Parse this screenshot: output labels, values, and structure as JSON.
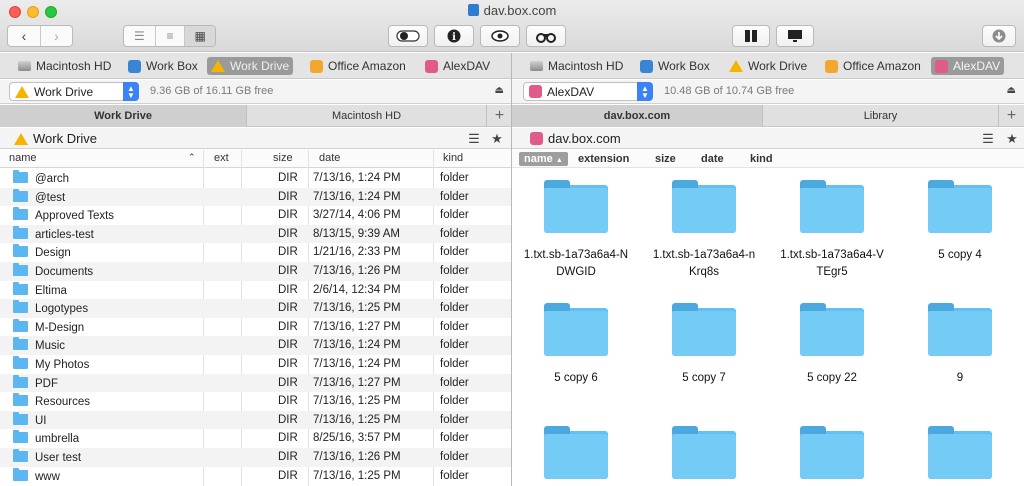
{
  "window": {
    "title": "dav.box.com"
  },
  "toolbar": {
    "back_icon": "chevron-left-icon",
    "forward_icon": "chevron-right-icon",
    "view_modes": [
      "list-view-icon",
      "detail-view-icon",
      "icon-view-icon"
    ],
    "buttons": [
      "toggle-icon",
      "info-icon",
      "eye-icon",
      "binoculars-icon",
      "pane-toggle-icon",
      "share-screen-icon",
      "download-icon"
    ]
  },
  "left": {
    "favorites": [
      {
        "label": "Macintosh HD",
        "icon": "harddrive-icon"
      },
      {
        "label": "Work Box",
        "icon": "box-icon"
      },
      {
        "label": "Work Drive",
        "icon": "google-drive-icon"
      },
      {
        "label": "Office Amazon",
        "icon": "amazon-icon"
      },
      {
        "label": "AlexDAV",
        "icon": "webdav-icon"
      }
    ],
    "drive": {
      "selected": "Work Drive",
      "free": "9.36 GB of 16.11 GB free"
    },
    "tabs": [
      {
        "label": "Work Drive"
      },
      {
        "label": "Macintosh HD"
      }
    ],
    "path": "Work Drive",
    "columns": {
      "name": "name",
      "ext": "ext",
      "size": "size",
      "date": "date",
      "kind": "kind"
    },
    "rows": [
      {
        "name": "@arch",
        "ext": "",
        "size": "DIR",
        "date": "7/13/16, 1:24 PM",
        "kind": "folder"
      },
      {
        "name": "@test",
        "ext": "",
        "size": "DIR",
        "date": "7/13/16, 1:24 PM",
        "kind": "folder"
      },
      {
        "name": "Approved Texts",
        "ext": "",
        "size": "DIR",
        "date": "3/27/14, 4:06 PM",
        "kind": "folder"
      },
      {
        "name": "articles-test",
        "ext": "",
        "size": "DIR",
        "date": "8/13/15, 9:39 AM",
        "kind": "folder"
      },
      {
        "name": "Design",
        "ext": "",
        "size": "DIR",
        "date": "1/21/16, 2:33 PM",
        "kind": "folder"
      },
      {
        "name": "Documents",
        "ext": "",
        "size": "DIR",
        "date": "7/13/16, 1:26 PM",
        "kind": "folder"
      },
      {
        "name": "Eltima",
        "ext": "",
        "size": "DIR",
        "date": "2/6/14, 12:34 PM",
        "kind": "folder"
      },
      {
        "name": "Logotypes",
        "ext": "",
        "size": "DIR",
        "date": "7/13/16, 1:25 PM",
        "kind": "folder"
      },
      {
        "name": "M-Design",
        "ext": "",
        "size": "DIR",
        "date": "7/13/16, 1:27 PM",
        "kind": "folder"
      },
      {
        "name": "Music",
        "ext": "",
        "size": "DIR",
        "date": "7/13/16, 1:24 PM",
        "kind": "folder"
      },
      {
        "name": "My Photos",
        "ext": "",
        "size": "DIR",
        "date": "7/13/16, 1:24 PM",
        "kind": "folder"
      },
      {
        "name": "PDF",
        "ext": "",
        "size": "DIR",
        "date": "7/13/16, 1:27 PM",
        "kind": "folder"
      },
      {
        "name": "Resources",
        "ext": "",
        "size": "DIR",
        "date": "7/13/16, 1:25 PM",
        "kind": "folder"
      },
      {
        "name": "UI",
        "ext": "",
        "size": "DIR",
        "date": "7/13/16, 1:25 PM",
        "kind": "folder"
      },
      {
        "name": "umbrella",
        "ext": "",
        "size": "DIR",
        "date": "8/25/16, 3:57 PM",
        "kind": "folder"
      },
      {
        "name": "User test",
        "ext": "",
        "size": "DIR",
        "date": "7/13/16, 1:26 PM",
        "kind": "folder"
      },
      {
        "name": "www",
        "ext": "",
        "size": "DIR",
        "date": "7/13/16, 1:25 PM",
        "kind": "folder"
      }
    ]
  },
  "right": {
    "favorites": [
      {
        "label": "Macintosh HD",
        "icon": "harddrive-icon"
      },
      {
        "label": "Work Box",
        "icon": "box-icon"
      },
      {
        "label": "Work Drive",
        "icon": "google-drive-icon"
      },
      {
        "label": "Office Amazon",
        "icon": "amazon-icon"
      },
      {
        "label": "AlexDAV",
        "icon": "webdav-icon"
      }
    ],
    "drive": {
      "selected": "AlexDAV",
      "free": "10.48 GB of 10.74 GB free"
    },
    "tabs": [
      {
        "label": "dav.box.com"
      },
      {
        "label": "Library"
      }
    ],
    "path": "dav.box.com",
    "columns": {
      "name": "name",
      "extension": "extension",
      "size": "size",
      "date": "date",
      "kind": "kind"
    },
    "items": [
      {
        "line1": "1.txt.sb-1a73a6a4-N",
        "line2": "DWGID"
      },
      {
        "line1": "1.txt.sb-1a73a6a4-n",
        "line2": "Krq8s"
      },
      {
        "line1": "1.txt.sb-1a73a6a4-V",
        "line2": "TEgr5"
      },
      {
        "line1": "5 copy 4",
        "line2": ""
      },
      {
        "line1": "5 copy 6",
        "line2": ""
      },
      {
        "line1": "5 copy 7",
        "line2": ""
      },
      {
        "line1": "5 copy 22",
        "line2": ""
      },
      {
        "line1": "9",
        "line2": ""
      },
      {
        "line1": "",
        "line2": ""
      },
      {
        "line1": "",
        "line2": ""
      },
      {
        "line1": "",
        "line2": ""
      },
      {
        "line1": "",
        "line2": ""
      }
    ]
  },
  "colors": {
    "folder": "#62c0f2",
    "accent": "#3b82f6"
  }
}
